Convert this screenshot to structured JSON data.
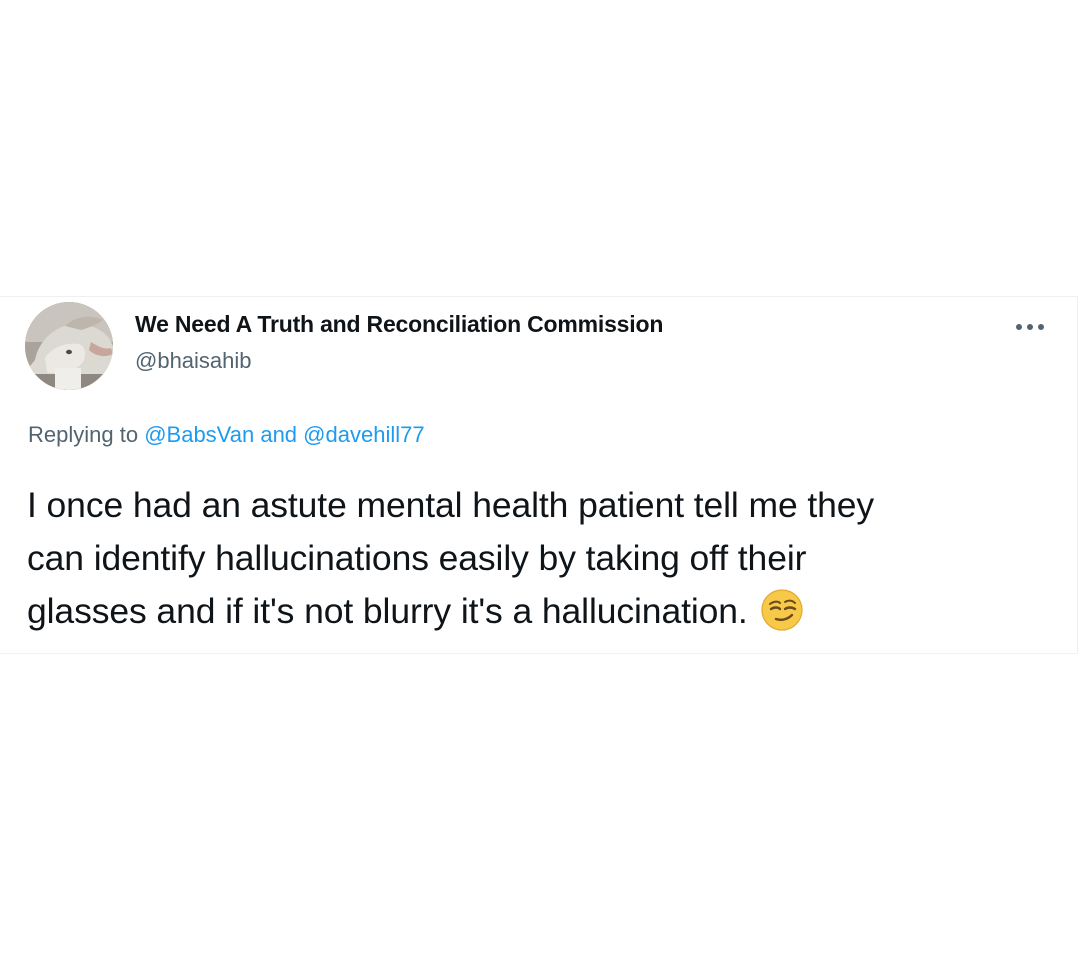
{
  "tweet": {
    "author": {
      "display_name": "We Need A Truth and Reconciliation Commission",
      "handle": "@bhaisahib"
    },
    "more_icon": "more-horizontal-icon",
    "reply": {
      "prefix": "Replying to",
      "mentions": [
        "@BabsVan",
        "@davehill77"
      ],
      "separator": "and"
    },
    "text_lines": [
      "I once had an astute mental health patient tell me they",
      "can identify hallucinations easily by taking off their",
      "glasses and if it's not blurry it's a hallucination."
    ],
    "emoji": "smirking-face-emoji",
    "colors": {
      "link": "#1d9bf0",
      "secondary_text": "#536471",
      "primary_text": "#0f1419",
      "emoji_fill": "#f7c948"
    }
  }
}
